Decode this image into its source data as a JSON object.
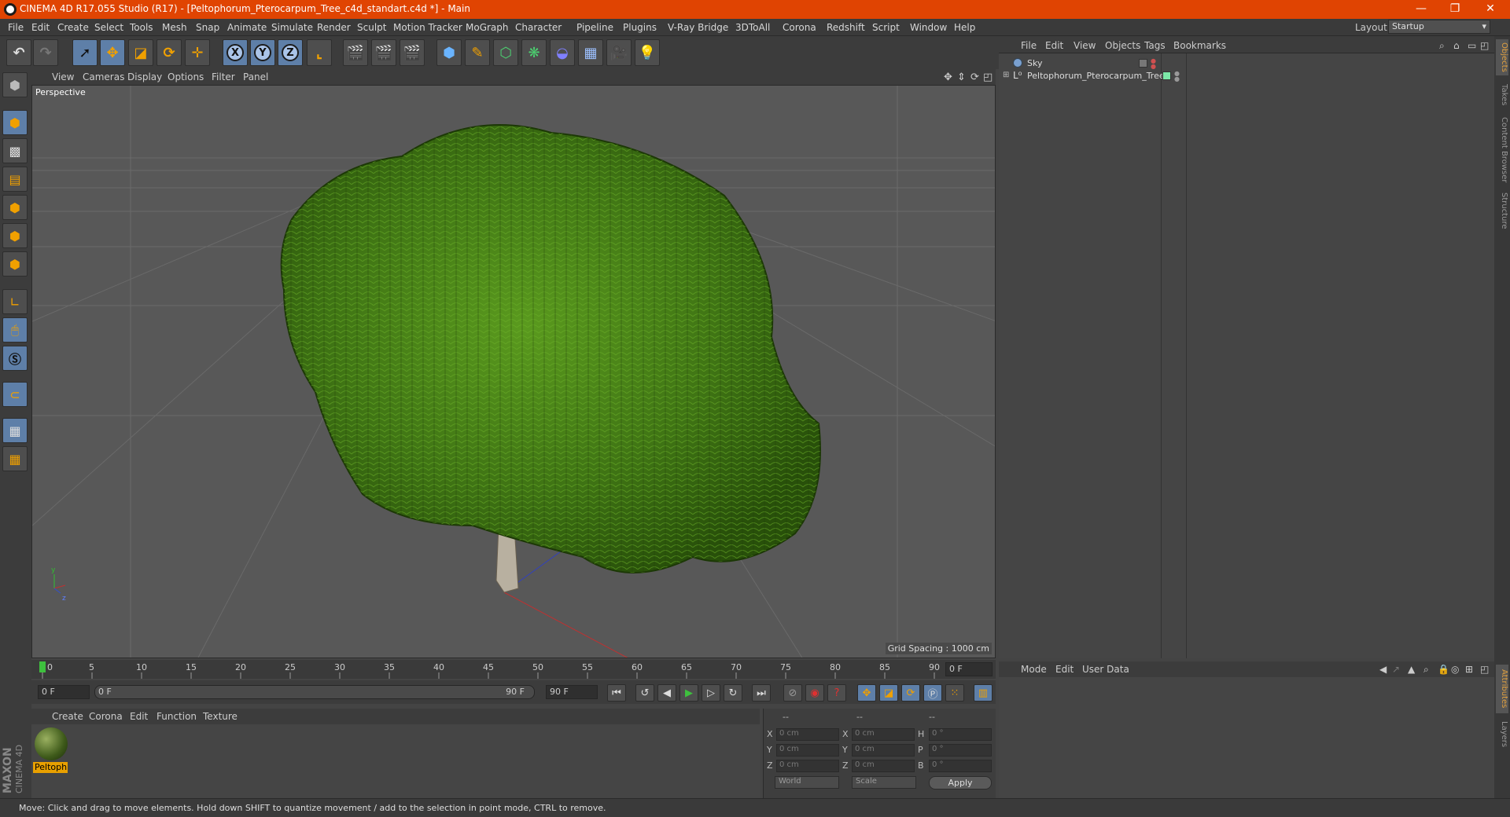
{
  "titlebar": {
    "title": "CINEMA 4D R17.055 Studio (R17) - [Peltophorum_Pterocarpum_Tree_c4d_standart.c4d *] - Main",
    "minimize": "—",
    "restore": "❐",
    "close": "✕"
  },
  "menubar": {
    "items": [
      "File",
      "Edit",
      "Create",
      "Select",
      "Tools",
      "Mesh",
      "Snap",
      "Animate",
      "Simulate",
      "Render",
      "Sculpt",
      "Motion Tracker",
      "MoGraph",
      "Character",
      "Pipeline",
      "Plugins",
      "V-Ray Bridge",
      "3DToAll",
      "Corona",
      "Redshift",
      "Script",
      "Window",
      "Help"
    ],
    "layout_label": "Layout:",
    "layout_value": "Startup"
  },
  "viewport": {
    "menu": [
      "View",
      "Cameras",
      "Display",
      "Options",
      "Filter",
      "Panel"
    ],
    "label": "Perspective",
    "grid_spacing": "Grid Spacing : 1000 cm",
    "axis_y": "y",
    "axis_z": "z"
  },
  "timeline": {
    "ticks": [
      "0",
      "5",
      "10",
      "15",
      "20",
      "25",
      "30",
      "35",
      "40",
      "45",
      "50",
      "55",
      "60",
      "65",
      "70",
      "75",
      "80",
      "85",
      "90"
    ],
    "current_frame": "0 F",
    "start_field": "0 F",
    "range_start": "0 F",
    "range_end": "90 F",
    "end_field": "90 F"
  },
  "material_manager": {
    "menu": [
      "Create",
      "Corona",
      "Edit",
      "Function",
      "Texture"
    ],
    "materials": [
      {
        "name": "Peltoph"
      }
    ]
  },
  "coordinates": {
    "headers": [
      "--",
      "--",
      "--"
    ],
    "rows": [
      {
        "l1": "X",
        "v1": "0 cm",
        "l2": "X",
        "v2": "0 cm",
        "l3": "H",
        "v3": "0 °"
      },
      {
        "l1": "Y",
        "v1": "0 cm",
        "l2": "Y",
        "v2": "0 cm",
        "l3": "P",
        "v3": "0 °"
      },
      {
        "l1": "Z",
        "v1": "0 cm",
        "l2": "Z",
        "v2": "0 cm",
        "l3": "B",
        "v3": "0 °"
      }
    ],
    "mode_world": "World",
    "mode_scale": "Scale",
    "apply": "Apply"
  },
  "object_manager": {
    "menu": [
      "File",
      "Edit",
      "View",
      "Objects",
      "Tags",
      "Bookmarks"
    ],
    "objects": [
      {
        "name": "Sky"
      },
      {
        "name": "Peltophorum_Pterocarpum_Tree"
      }
    ]
  },
  "attributes": {
    "menu": [
      "Mode",
      "Edit",
      "User Data"
    ]
  },
  "right_tabs": [
    "Objects",
    "Takes",
    "Content Browser",
    "Structure",
    "Attributes",
    "Layers"
  ],
  "status": "Move: Click and drag to move elements. Hold down SHIFT to quantize movement / add to the selection in point mode, CTRL to remove.",
  "branding": {
    "maxon": "MAXON",
    "c4d": "CINEMA 4D"
  },
  "colors": {
    "title_bar": "#e04402",
    "accent": "#5e7fa8",
    "material_label": "#e8a000",
    "play": "#3ec03e"
  }
}
